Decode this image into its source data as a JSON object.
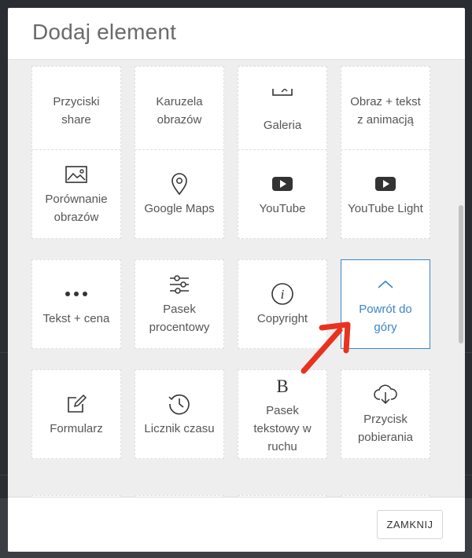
{
  "modal": {
    "title": "Dodaj element",
    "close_label": "ZAMKNIJ"
  },
  "tiles": [
    {
      "label": "Przyciski share",
      "icon": "share-icon"
    },
    {
      "label": "Karuzela obrazów",
      "icon": "carousel-icon"
    },
    {
      "label": "Galeria",
      "icon": "gallery-icon"
    },
    {
      "label": "Obraz + tekst z animacją",
      "icon": "image-text-animation-icon"
    },
    {
      "label": "Porównanie obrazów",
      "icon": "image-compare-icon"
    },
    {
      "label": "Google Maps",
      "icon": "map-pin-icon"
    },
    {
      "label": "YouTube",
      "icon": "youtube-icon"
    },
    {
      "label": "YouTube Light",
      "icon": "youtube-icon"
    },
    {
      "label": "Tekst + cena",
      "icon": "dots-icon"
    },
    {
      "label": "Pasek procentowy",
      "icon": "sliders-icon"
    },
    {
      "label": "Copyright",
      "icon": "info-icon"
    },
    {
      "label": "Powrót do góry",
      "icon": "chevron-up-icon",
      "selected": true
    },
    {
      "label": "Formularz",
      "icon": "edit-form-icon"
    },
    {
      "label": "Licznik czasu",
      "icon": "clock-icon"
    },
    {
      "label": "Pasek tekstowy w ruchu",
      "icon": "bold-b-icon"
    },
    {
      "label": "Przycisk pobierania",
      "icon": "cloud-download-icon"
    },
    {
      "label": "",
      "icon": ""
    },
    {
      "label": "",
      "icon": ""
    },
    {
      "label": "",
      "icon": ""
    },
    {
      "label": "",
      "icon": ""
    }
  ],
  "colors": {
    "accent": "#3a86c8",
    "annotation_arrow": "#e8321f"
  }
}
